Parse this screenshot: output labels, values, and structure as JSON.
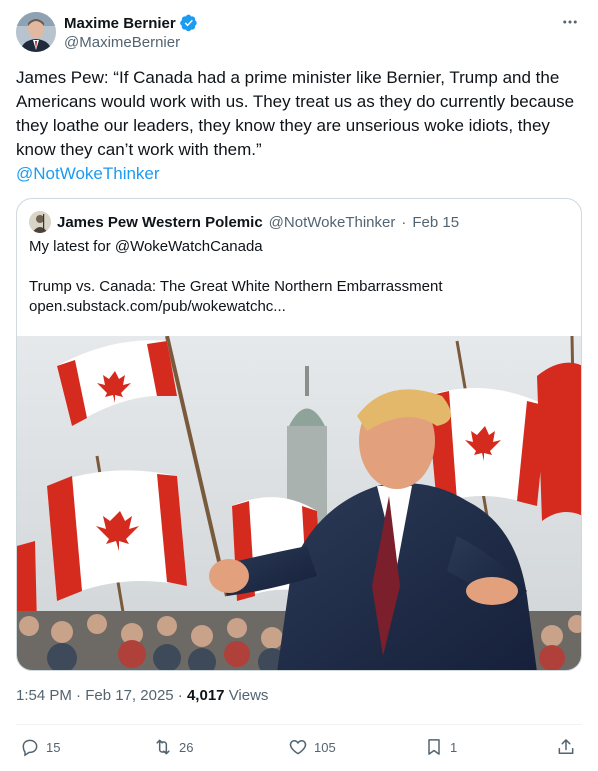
{
  "author": {
    "name": "Maxime Bernier",
    "handle": "@MaximeBernier"
  },
  "tweet": {
    "text": "James Pew: “If Canada had a prime minister like Bernier, Trump and the Americans would work with us. They treat us as they do currently because they loathe our leaders, they know they are unserious woke idiots, they know they can’t work with them.”",
    "mention": "@NotWokeThinker"
  },
  "quote": {
    "name": "James Pew Western Polemic",
    "handle": "@NotWokeThinker",
    "separator": "·",
    "date": "Feb 15",
    "line1": "My latest for @WokeWatchCanada",
    "line2": "Trump vs. Canada: The Great White Northern Embarrassment",
    "line3": "open.substack.com/pub/wokewatchc..."
  },
  "meta": {
    "time": "1:54 PM",
    "separator": "·",
    "date": "Feb 17, 2025",
    "views_count": "4,017",
    "views_label": "Views"
  },
  "actions": {
    "replies": "15",
    "reposts": "26",
    "likes": "105",
    "bookmarks": "1"
  },
  "colors": {
    "accent": "#1d9bf0",
    "secondary_text": "#536471",
    "border": "#cfd9de",
    "canada_red": "#d52b1e"
  },
  "icons": [
    "verified-badge-icon",
    "more-icon",
    "reply-icon",
    "repost-icon",
    "like-icon",
    "bookmark-icon",
    "share-icon"
  ]
}
